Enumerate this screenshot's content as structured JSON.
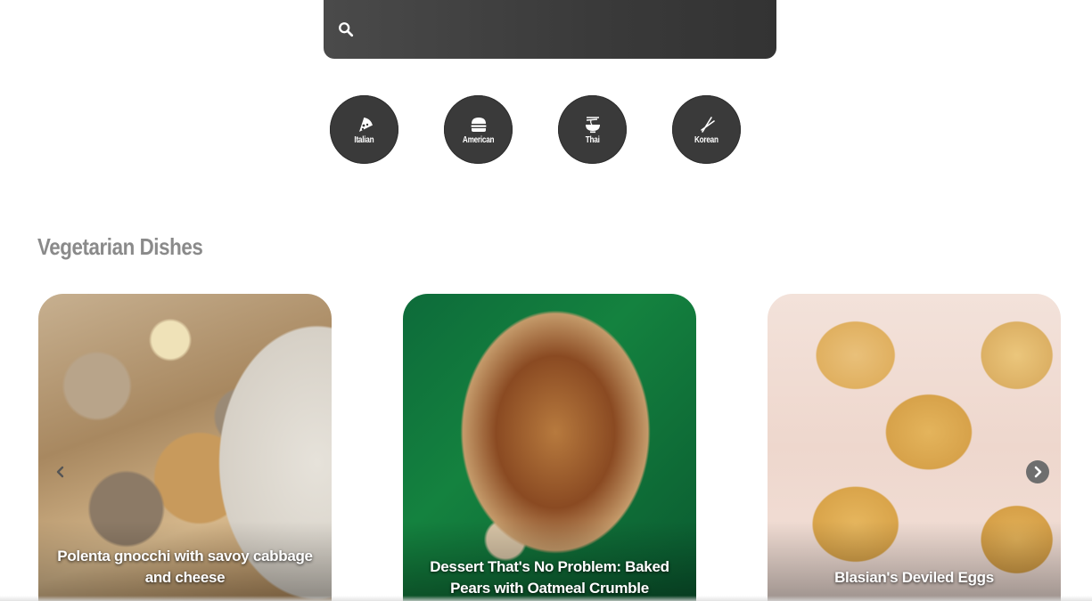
{
  "search": {
    "value": "",
    "placeholder": "",
    "icon": "search-icon"
  },
  "cuisines": [
    {
      "label": "Italian",
      "icon": "pizza-icon"
    },
    {
      "label": "American",
      "icon": "burger-icon"
    },
    {
      "label": "Thai",
      "icon": "noodle-bowl-icon"
    },
    {
      "label": "Korean",
      "icon": "chopsticks-icon"
    }
  ],
  "section": {
    "title": "Vegetarian Dishes"
  },
  "cards": [
    {
      "title": "Polenta gnocchi with savoy cabbage and cheese"
    },
    {
      "title": "Dessert That's No Problem: Baked Pears with Oatmeal Crumble"
    },
    {
      "title": "Blasian's Deviled Eggs"
    }
  ],
  "carousel": {
    "prev_icon": "chevron-left-icon",
    "next_icon": "chevron-right-icon"
  },
  "colors": {
    "dark": "#3a3a3a",
    "section_title": "#8a8a8a",
    "white": "#ffffff"
  }
}
